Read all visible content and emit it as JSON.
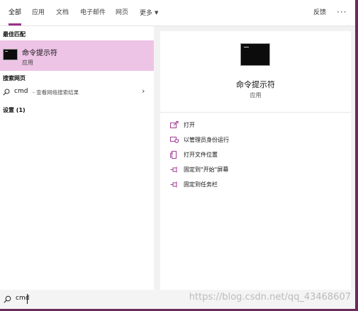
{
  "tabs": [
    {
      "label": "全部",
      "active": true
    },
    {
      "label": "应用"
    },
    {
      "label": "文档"
    },
    {
      "label": "电子邮件"
    },
    {
      "label": "网页"
    },
    {
      "label": "更多"
    }
  ],
  "header": {
    "feedback": "反馈",
    "more_options": "···"
  },
  "left": {
    "best_match_heading": "最佳匹配",
    "best_match": {
      "title": "命令提示符",
      "subtitle": "应用"
    },
    "web_heading": "搜索网页",
    "web_item": {
      "term": "cmd",
      "description": "- 查看网络搜索结果"
    },
    "settings_heading": "设置 (1)"
  },
  "detail": {
    "title": "命令提示符",
    "subtitle": "应用",
    "actions": [
      {
        "label": "打开",
        "icon": "open-icon"
      },
      {
        "label": "以管理员身份运行",
        "icon": "shield-admin-icon"
      },
      {
        "label": "打开文件位置",
        "icon": "file-location-icon"
      },
      {
        "label": "固定到\"开始\"屏幕",
        "icon": "pin-icon"
      },
      {
        "label": "固定到任务栏",
        "icon": "pin-icon"
      }
    ]
  },
  "search": {
    "value": "cmd"
  },
  "watermark": "https://blog.csdn.net/qq_43468607",
  "colors": {
    "accent": "#9a2f8a",
    "highlight": "#eec4e6",
    "icon_accent": "#a13a94"
  }
}
